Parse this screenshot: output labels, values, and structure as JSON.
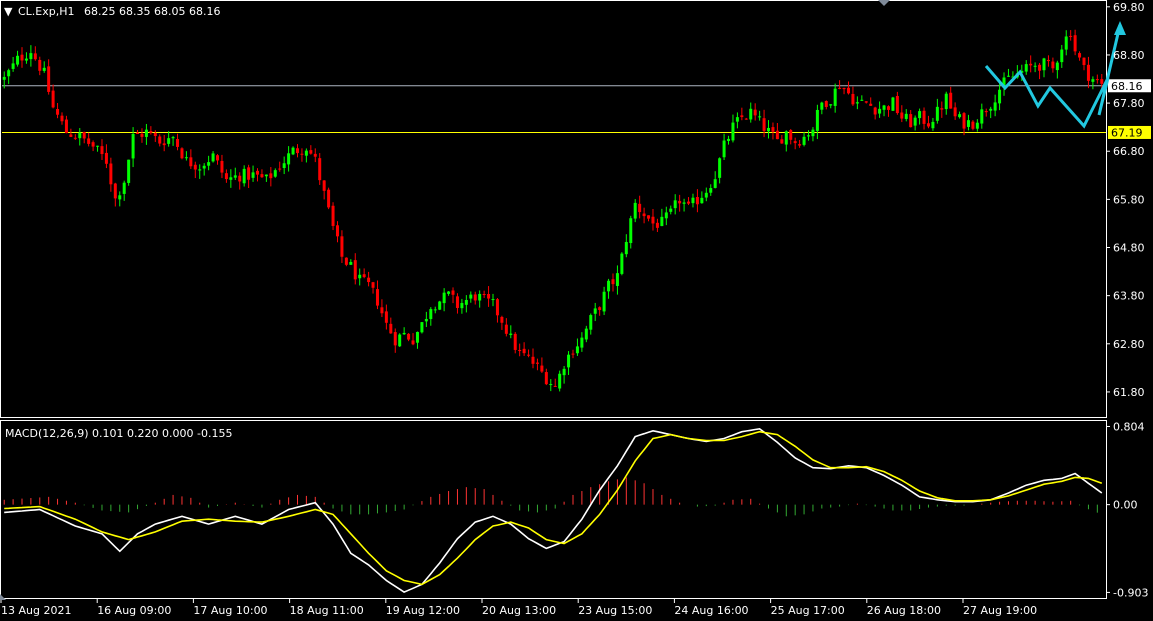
{
  "header": {
    "symbol": "CL.Exp,H1",
    "ohlc": "68.25 68.35 68.05 68.16"
  },
  "macd_header": "MACD(12,26,9) 0.101 0.220 0.000 -0.155",
  "colors": {
    "background": "#000000",
    "bull": "#00ff00",
    "bear": "#ff0000",
    "macd_line": "#ffffff",
    "signal_line": "#ffff00",
    "hist_pos": "#ff3333",
    "hist_neg": "#33aa33",
    "forecast": "#22c8e0",
    "level_current": "#aeb6c2",
    "level_marker": "#ffff00"
  },
  "price_levels": [
    {
      "value": 68.16,
      "label": "68.16",
      "style": "current"
    },
    {
      "value": 67.19,
      "label": "67.19",
      "style": "marker"
    }
  ],
  "chart_data": [
    {
      "type": "candlestick",
      "title": "",
      "ylim": [
        61.3,
        69.9
      ],
      "y_ticks": [
        69.8,
        68.8,
        67.8,
        66.8,
        65.8,
        64.8,
        63.8,
        62.8,
        61.8
      ],
      "y_tick_labels": [
        "69.80",
        "68.80",
        "67.80",
        "66.80",
        "65.80",
        "64.80",
        "63.80",
        "62.80",
        "61.80"
      ],
      "x_tick_labels": [
        "13 Aug 2021",
        "16 Aug 09:00",
        "17 Aug 10:00",
        "18 Aug 11:00",
        "19 Aug 12:00",
        "20 Aug 13:00",
        "23 Aug 15:00",
        "24 Aug 16:00",
        "25 Aug 17:00",
        "26 Aug 18:00",
        "27 Aug 19:00"
      ],
      "trend_close": [
        [
          0,
          68.3
        ],
        [
          3,
          68.7
        ],
        [
          6,
          68.9
        ],
        [
          9,
          68.4
        ],
        [
          11,
          67.7
        ],
        [
          14,
          67.2
        ],
        [
          17,
          67.1
        ],
        [
          20,
          66.9
        ],
        [
          23,
          66.6
        ],
        [
          25,
          65.8
        ],
        [
          27,
          66.2
        ],
        [
          29,
          67.1
        ],
        [
          32,
          67.2
        ],
        [
          35,
          67.0
        ],
        [
          38,
          67.1
        ],
        [
          41,
          66.6
        ],
        [
          44,
          66.5
        ],
        [
          47,
          66.7
        ],
        [
          50,
          66.2
        ],
        [
          53,
          66.3
        ],
        [
          56,
          66.3
        ],
        [
          59,
          66.2
        ],
        [
          62,
          66.5
        ],
        [
          65,
          66.8
        ],
        [
          68,
          66.9
        ],
        [
          70,
          66.6
        ],
        [
          72,
          65.9
        ],
        [
          74,
          65.2
        ],
        [
          76,
          64.6
        ],
        [
          78,
          64.4
        ],
        [
          80,
          64.1
        ],
        [
          82,
          64.0
        ],
        [
          84,
          63.7
        ],
        [
          86,
          63.2
        ],
        [
          88,
          62.9
        ],
        [
          90,
          63.0
        ],
        [
          92,
          62.9
        ],
        [
          94,
          63.2
        ],
        [
          96,
          63.6
        ],
        [
          98,
          63.7
        ],
        [
          100,
          63.8
        ],
        [
          102,
          63.6
        ],
        [
          104,
          63.7
        ],
        [
          106,
          63.8
        ],
        [
          108,
          63.7
        ],
        [
          110,
          63.6
        ],
        [
          112,
          63.3
        ],
        [
          114,
          62.9
        ],
        [
          116,
          62.6
        ],
        [
          118,
          62.5
        ],
        [
          120,
          62.3
        ],
        [
          122,
          62.1
        ],
        [
          124,
          61.9
        ],
        [
          126,
          62.4
        ],
        [
          128,
          62.7
        ],
        [
          130,
          62.9
        ],
        [
          132,
          63.3
        ],
        [
          134,
          63.6
        ],
        [
          136,
          64.0
        ],
        [
          138,
          64.2
        ],
        [
          140,
          65.0
        ],
        [
          142,
          65.7
        ],
        [
          144,
          65.5
        ],
        [
          146,
          65.3
        ],
        [
          148,
          65.3
        ],
        [
          150,
          65.5
        ],
        [
          152,
          65.8
        ],
        [
          154,
          65.6
        ],
        [
          156,
          65.8
        ],
        [
          158,
          66.0
        ],
        [
          160,
          66.3
        ],
        [
          162,
          66.9
        ],
        [
          164,
          67.3
        ],
        [
          166,
          67.5
        ],
        [
          168,
          67.6
        ],
        [
          170,
          67.4
        ],
        [
          172,
          67.2
        ],
        [
          174,
          67.0
        ],
        [
          176,
          67.2
        ],
        [
          178,
          67.0
        ],
        [
          180,
          67.1
        ],
        [
          182,
          67.3
        ],
        [
          184,
          67.8
        ],
        [
          186,
          67.9
        ],
        [
          188,
          68.2
        ],
        [
          190,
          68.0
        ],
        [
          192,
          67.8
        ],
        [
          194,
          67.8
        ],
        [
          196,
          67.7
        ],
        [
          198,
          67.7
        ],
        [
          200,
          67.8
        ],
        [
          202,
          67.5
        ],
        [
          204,
          67.4
        ],
        [
          206,
          67.5
        ],
        [
          208,
          67.4
        ],
        [
          210,
          67.6
        ],
        [
          212,
          67.9
        ],
        [
          214,
          67.5
        ],
        [
          216,
          67.4
        ],
        [
          218,
          67.4
        ],
        [
          220,
          67.6
        ],
        [
          222,
          67.8
        ],
        [
          224,
          68.1
        ],
        [
          226,
          68.3
        ],
        [
          228,
          68.4
        ],
        [
          230,
          68.5
        ],
        [
          232,
          68.6
        ],
        [
          234,
          68.6
        ],
        [
          236,
          68.5
        ],
        [
          238,
          69.0
        ],
        [
          240,
          69.3
        ],
        [
          241,
          68.9
        ],
        [
          243,
          68.5
        ],
        [
          245,
          68.3
        ],
        [
          247,
          68.16
        ]
      ],
      "candle_count": 248
    },
    {
      "type": "line",
      "title": "MACD(12,26,9)",
      "ylim": [
        -0.95,
        0.85
      ],
      "y_ticks": [
        0.804,
        0.0,
        -0.903
      ],
      "y_tick_labels": [
        "0.804",
        "0.00",
        "-0.903"
      ],
      "series": [
        {
          "name": "",
          "style": "main",
          "points": [
            [
              0,
              -0.08
            ],
            [
              8,
              -0.05
            ],
            [
              16,
              -0.22
            ],
            [
              22,
              -0.3
            ],
            [
              26,
              -0.48
            ],
            [
              30,
              -0.3
            ],
            [
              34,
              -0.2
            ],
            [
              40,
              -0.12
            ],
            [
              46,
              -0.2
            ],
            [
              52,
              -0.12
            ],
            [
              58,
              -0.2
            ],
            [
              64,
              -0.05
            ],
            [
              70,
              0.02
            ],
            [
              74,
              -0.2
            ],
            [
              78,
              -0.5
            ],
            [
              82,
              -0.62
            ],
            [
              86,
              -0.78
            ],
            [
              90,
              -0.9
            ],
            [
              94,
              -0.82
            ],
            [
              98,
              -0.6
            ],
            [
              102,
              -0.35
            ],
            [
              106,
              -0.18
            ],
            [
              110,
              -0.12
            ],
            [
              114,
              -0.2
            ],
            [
              118,
              -0.35
            ],
            [
              122,
              -0.45
            ],
            [
              126,
              -0.38
            ],
            [
              130,
              -0.15
            ],
            [
              134,
              0.15
            ],
            [
              138,
              0.4
            ],
            [
              142,
              0.7
            ],
            [
              146,
              0.76
            ],
            [
              150,
              0.72
            ],
            [
              154,
              0.68
            ],
            [
              158,
              0.65
            ],
            [
              162,
              0.68
            ],
            [
              166,
              0.75
            ],
            [
              170,
              0.78
            ],
            [
              174,
              0.64
            ],
            [
              178,
              0.48
            ],
            [
              182,
              0.38
            ],
            [
              186,
              0.37
            ],
            [
              190,
              0.4
            ],
            [
              194,
              0.38
            ],
            [
              198,
              0.3
            ],
            [
              202,
              0.2
            ],
            [
              206,
              0.08
            ],
            [
              210,
              0.05
            ],
            [
              214,
              0.03
            ],
            [
              218,
              0.03
            ],
            [
              222,
              0.05
            ],
            [
              226,
              0.12
            ],
            [
              230,
              0.2
            ],
            [
              234,
              0.25
            ],
            [
              238,
              0.27
            ],
            [
              241,
              0.32
            ],
            [
              244,
              0.22
            ],
            [
              247,
              0.12
            ]
          ]
        },
        {
          "name": "",
          "style": "signal",
          "points": [
            [
              0,
              -0.04
            ],
            [
              8,
              -0.02
            ],
            [
              16,
              -0.15
            ],
            [
              22,
              -0.28
            ],
            [
              28,
              -0.36
            ],
            [
              34,
              -0.28
            ],
            [
              40,
              -0.17
            ],
            [
              46,
              -0.15
            ],
            [
              52,
              -0.17
            ],
            [
              58,
              -0.18
            ],
            [
              64,
              -0.12
            ],
            [
              70,
              -0.05
            ],
            [
              74,
              -0.1
            ],
            [
              78,
              -0.3
            ],
            [
              82,
              -0.5
            ],
            [
              86,
              -0.68
            ],
            [
              90,
              -0.78
            ],
            [
              94,
              -0.82
            ],
            [
              98,
              -0.72
            ],
            [
              102,
              -0.55
            ],
            [
              106,
              -0.36
            ],
            [
              110,
              -0.22
            ],
            [
              114,
              -0.18
            ],
            [
              118,
              -0.24
            ],
            [
              122,
              -0.36
            ],
            [
              126,
              -0.4
            ],
            [
              130,
              -0.3
            ],
            [
              134,
              -0.1
            ],
            [
              138,
              0.15
            ],
            [
              142,
              0.45
            ],
            [
              146,
              0.68
            ],
            [
              150,
              0.72
            ],
            [
              154,
              0.68
            ],
            [
              158,
              0.66
            ],
            [
              162,
              0.66
            ],
            [
              166,
              0.7
            ],
            [
              170,
              0.75
            ],
            [
              174,
              0.72
            ],
            [
              178,
              0.6
            ],
            [
              182,
              0.46
            ],
            [
              186,
              0.38
            ],
            [
              190,
              0.38
            ],
            [
              194,
              0.39
            ],
            [
              198,
              0.34
            ],
            [
              202,
              0.25
            ],
            [
              206,
              0.14
            ],
            [
              210,
              0.07
            ],
            [
              214,
              0.04
            ],
            [
              218,
              0.04
            ],
            [
              222,
              0.05
            ],
            [
              226,
              0.09
            ],
            [
              230,
              0.15
            ],
            [
              234,
              0.21
            ],
            [
              238,
              0.24
            ],
            [
              241,
              0.28
            ],
            [
              244,
              0.27
            ],
            [
              247,
              0.22
            ]
          ]
        }
      ],
      "histogram": [
        [
          0,
          0.05
        ],
        [
          10,
          0.08
        ],
        [
          16,
          0.02
        ],
        [
          22,
          -0.06
        ],
        [
          28,
          -0.08
        ],
        [
          34,
          0.02
        ],
        [
          38,
          0.1
        ],
        [
          42,
          0.07
        ],
        [
          46,
          -0.03
        ],
        [
          52,
          0.02
        ],
        [
          58,
          -0.03
        ],
        [
          62,
          0.05
        ],
        [
          66,
          0.1
        ],
        [
          70,
          0.08
        ],
        [
          74,
          -0.04
        ],
        [
          78,
          -0.1
        ],
        [
          82,
          -0.1
        ],
        [
          86,
          -0.08
        ],
        [
          90,
          -0.05
        ],
        [
          96,
          0.08
        ],
        [
          100,
          0.14
        ],
        [
          104,
          0.18
        ],
        [
          108,
          0.16
        ],
        [
          112,
          0.04
        ],
        [
          116,
          -0.06
        ],
        [
          120,
          -0.08
        ],
        [
          124,
          -0.04
        ],
        [
          128,
          0.1
        ],
        [
          132,
          0.18
        ],
        [
          136,
          0.24
        ],
        [
          140,
          0.28
        ],
        [
          144,
          0.22
        ],
        [
          148,
          0.1
        ],
        [
          152,
          0.02
        ],
        [
          156,
          -0.02
        ],
        [
          160,
          -0.01
        ],
        [
          164,
          0.05
        ],
        [
          168,
          0.06
        ],
        [
          172,
          -0.04
        ],
        [
          176,
          -0.12
        ],
        [
          180,
          -0.1
        ],
        [
          184,
          -0.04
        ],
        [
          188,
          -0.02
        ],
        [
          192,
          0.01
        ],
        [
          196,
          -0.02
        ],
        [
          200,
          -0.06
        ],
        [
          204,
          -0.06
        ],
        [
          208,
          -0.03
        ],
        [
          212,
          -0.01
        ],
        [
          216,
          -0.01
        ],
        [
          220,
          0.01
        ],
        [
          224,
          0.03
        ],
        [
          228,
          0.04
        ],
        [
          232,
          0.04
        ],
        [
          236,
          0.03
        ],
        [
          240,
          0.04
        ],
        [
          243,
          -0.03
        ],
        [
          247,
          -0.1
        ]
      ]
    }
  ],
  "forecast_path": [
    [
      986,
      66
    ],
    [
      1005,
      88
    ],
    [
      1020,
      72
    ],
    [
      1038,
      106
    ],
    [
      1050,
      88
    ],
    [
      1084,
      126
    ],
    [
      1108,
      78
    ],
    [
      1099,
      115
    ],
    [
      1120,
      25
    ]
  ]
}
